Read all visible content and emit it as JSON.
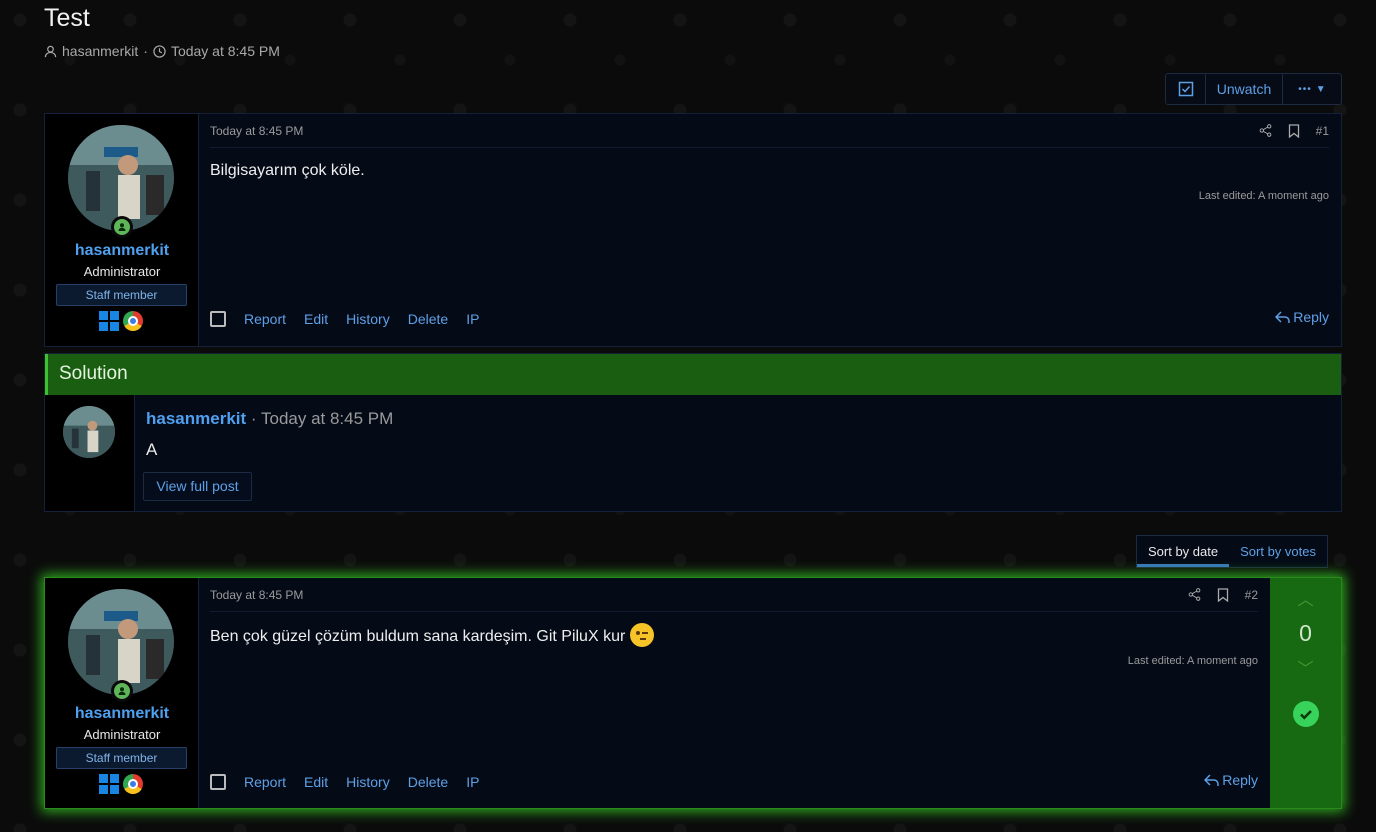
{
  "thread": {
    "title": "Test",
    "author": "hasanmerkit",
    "separator": "·",
    "time": "Today at 8:45 PM"
  },
  "watch": {
    "unwatch_label": "Unwatch",
    "more_label": "•••"
  },
  "posts": [
    {
      "author": "hasanmerkit",
      "role": "Administrator",
      "staff": "Staff member",
      "time": "Today at 8:45 PM",
      "number": "#1",
      "body": "Bilgisayarım çok köle.",
      "edited": "Last edited: A moment ago",
      "actions": [
        "Report",
        "Edit",
        "History",
        "Delete",
        "IP"
      ],
      "reply": "Reply"
    },
    {
      "author": "hasanmerkit",
      "role": "Administrator",
      "staff": "Staff member",
      "time": "Today at 8:45 PM",
      "number": "#2",
      "body": "Ben çok güzel çözüm buldum sana kardeşim. Git PiluX kur",
      "edited": "Last edited: A moment ago",
      "actions": [
        "Report",
        "Edit",
        "History",
        "Delete",
        "IP"
      ],
      "reply": "Reply",
      "votes": "0"
    }
  ],
  "solution": {
    "heading": "Solution",
    "author": "hasanmerkit",
    "meta": "· Today at 8:45 PM",
    "body": "A",
    "button": "View full post"
  },
  "sort": {
    "by_date": "Sort by date",
    "by_votes": "Sort by votes"
  },
  "colors": {
    "accent": "#4fa0ef",
    "solution": "#1a5e12",
    "vote": "#176a12"
  }
}
